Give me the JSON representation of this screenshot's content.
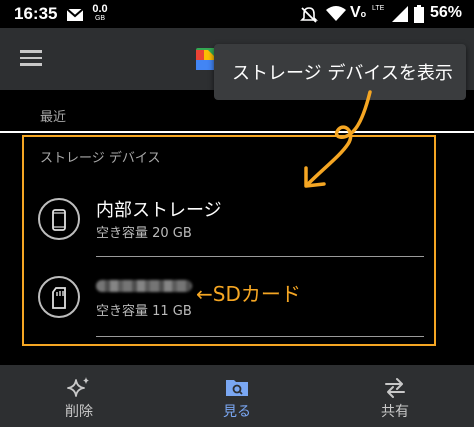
{
  "status_bar": {
    "time": "16:35",
    "data_speed_value": "0.0",
    "data_speed_unit": "GB",
    "network_label": "VoLTE",
    "battery": "56%",
    "icons": [
      "mail-icon",
      "mute-icon",
      "wifi-icon",
      "signal-icon",
      "battery-icon"
    ]
  },
  "app_bar": {
    "menu_icon": "menu-icon",
    "logo": "files-app-logo"
  },
  "tooltip": {
    "text": "ストレージ デバイスを表示"
  },
  "sections": {
    "recent": "最近",
    "storage_devices": "ストレージ デバイス"
  },
  "devices": [
    {
      "name": "内部ストレージ",
      "free": "空き容量 20 GB",
      "icon": "phone-icon"
    },
    {
      "name": "",
      "free": "空き容量 11 GB",
      "icon": "sd-card-icon",
      "name_redacted": true
    }
  ],
  "annotations": {
    "sd_label": "←SDカード",
    "arrow_color": "#f5a623"
  },
  "bottom_nav": {
    "items": [
      {
        "label": "削除",
        "icon": "sparkle-icon",
        "active": false
      },
      {
        "label": "見る",
        "icon": "browse-icon",
        "active": true
      },
      {
        "label": "共有",
        "icon": "share-arrows-icon",
        "active": false
      }
    ]
  },
  "colors": {
    "accent": "#7aa7f2",
    "annotation": "#f5a623",
    "bar_background": "#2d2f31"
  }
}
